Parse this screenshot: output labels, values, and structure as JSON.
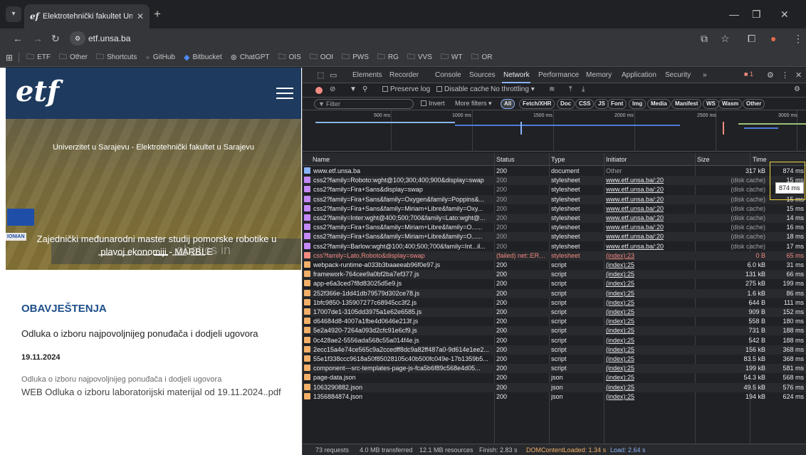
{
  "browser": {
    "tab_title": "Elektrotehnički fakultet Univerzi",
    "tab_favicon": "etf-logo",
    "url": "etf.unsa.ba",
    "bookmarks": [
      {
        "label": "ETF",
        "icon": "folder-icon"
      },
      {
        "label": "Other",
        "icon": "folder-icon"
      },
      {
        "label": "Shortcuts",
        "icon": "folder-icon"
      },
      {
        "label": "GitHub",
        "icon": "github-icon"
      },
      {
        "label": "Bitbucket",
        "icon": "bitbucket-icon"
      },
      {
        "label": "ChatGPT",
        "icon": "chatgpt-icon"
      },
      {
        "label": "OIS",
        "icon": "folder-icon"
      },
      {
        "label": "OOI",
        "icon": "folder-icon"
      },
      {
        "label": "PWS",
        "icon": "folder-icon"
      },
      {
        "label": "RG",
        "icon": "folder-icon"
      },
      {
        "label": "VVS",
        "icon": "folder-icon"
      },
      {
        "label": "WT",
        "icon": "folder-icon"
      },
      {
        "label": "OR",
        "icon": "folder-icon"
      }
    ]
  },
  "site": {
    "logo_text": "etf",
    "hero_university": "Univerzitet u Sarajevu - Elektrotehnički fakultet u Sarajevu",
    "hero_headline": "Zajednički međunarodni master studij pomorske robotike u plavoj ekonomiji - MARBLE",
    "hero_background_word": "obotics in",
    "hero_partner": "IONIAN",
    "news_section_title": "OBAVJEŠTENJA",
    "news_headline": "Odluka o izboru najpovoljnijeg ponuđača i dodjeli ugovora",
    "news_date": "19.11.2024",
    "news_excerpt": "Odluka o izboru najpovoljnijeg ponuđača i dodjeli ugovora",
    "news_file": "WEB Odluka o izboru laboratorijski materijal od 19.11.2024..pdf"
  },
  "devtools": {
    "tabs": [
      "Elements",
      "Recorder",
      "Console",
      "Sources",
      "Network",
      "Performance",
      "Memory",
      "Application",
      "Security"
    ],
    "active_tab": "Network",
    "error_badge": "1",
    "toolbar": {
      "preserve_log": "Preserve log",
      "disable_cache": "Disable cache",
      "throttling": "No throttling"
    },
    "filter": {
      "placeholder": "Filter",
      "invert": "Invert",
      "more_filters": "More filters",
      "chips": [
        "All",
        "Fetch/XHR",
        "Doc",
        "CSS",
        "JS",
        "Font",
        "Img",
        "Media",
        "Manifest",
        "WS",
        "Wasm",
        "Other"
      ]
    },
    "overview_ticks": [
      "500 ms",
      "1000 ms",
      "1500 ms",
      "2000 ms",
      "2500 ms",
      "3000 ms"
    ],
    "columns": {
      "name": "Name",
      "status": "Status",
      "type": "Type",
      "initiator": "Initiator",
      "size": "Size",
      "time": "Time"
    },
    "requests": [
      {
        "name": "www.etf.unsa.ba",
        "status": "200",
        "type": "document",
        "initiator": "Other",
        "size": "317 kB",
        "time": "874 ms",
        "kind": "doc"
      },
      {
        "name": "css2?family=Roboto:wght@100;300;400;900&display=swap",
        "status": "200",
        "type": "stylesheet",
        "initiator": "www.etf.unsa.ba/:20",
        "size": "(disk cache)",
        "time": "15 ms",
        "kind": "css"
      },
      {
        "name": "css2?family=Fira+Sans&display=swap",
        "status": "200",
        "type": "stylesheet",
        "initiator": "www.etf.unsa.ba/:20",
        "size": "(disk cache)",
        "time": "15 ms",
        "kind": "css"
      },
      {
        "name": "css2?family=Fira+Sans&family=Oxygen&family=Poppins&...",
        "status": "200",
        "type": "stylesheet",
        "initiator": "www.etf.unsa.ba/:20",
        "size": "(disk cache)",
        "time": "15 ms",
        "kind": "css"
      },
      {
        "name": "css2?family=Fira+Sans&family=Miriam+Libre&family=Oxy...",
        "status": "200",
        "type": "stylesheet",
        "initiator": "www.etf.unsa.ba/:20",
        "size": "(disk cache)",
        "time": "15 ms",
        "kind": "css"
      },
      {
        "name": "css2?family=Inter:wght@400;500;700&family=Lato:wght@...",
        "status": "200",
        "type": "stylesheet",
        "initiator": "www.etf.unsa.ba/:20",
        "size": "(disk cache)",
        "time": "14 ms",
        "kind": "css"
      },
      {
        "name": "css2?family=Fira+Sans&family=Miriam+Libre&family=O......",
        "status": "200",
        "type": "stylesheet",
        "initiator": "www.etf.unsa.ba/:20",
        "size": "(disk cache)",
        "time": "16 ms",
        "kind": "css"
      },
      {
        "name": "css2?family=Fira+Sans&family=Miriam+Libre&family=O......",
        "status": "200",
        "type": "stylesheet",
        "initiator": "www.etf.unsa.ba/:20",
        "size": "(disk cache)",
        "time": "18 ms",
        "kind": "css"
      },
      {
        "name": "css2?family=Barlow:wght@100;400;500;700&family=Int...il...",
        "status": "200",
        "type": "stylesheet",
        "initiator": "www.etf.unsa.ba/:20",
        "size": "(disk cache)",
        "time": "17 ms",
        "kind": "css"
      },
      {
        "name": "css?family=Lato,Roboto&display=swap",
        "status": "(failed) net::ERR...",
        "type": "stylesheet",
        "initiator": "(index):23",
        "size": "0 B",
        "time": "65 ms",
        "kind": "fail"
      },
      {
        "name": "webpack-runtime-a033b3baaeeab96f0e97.js",
        "status": "200",
        "type": "script",
        "initiator": "(index):25",
        "size": "6.0 kB",
        "time": "31 ms",
        "kind": "js"
      },
      {
        "name": "framework-764cee9a0bf2ba7ef377.js",
        "status": "200",
        "type": "script",
        "initiator": "(index):25",
        "size": "131 kB",
        "time": "66 ms",
        "kind": "js"
      },
      {
        "name": "app-e6a3ced7f8d83025d5e9.js",
        "status": "200",
        "type": "script",
        "initiator": "(index):25",
        "size": "275 kB",
        "time": "199 ms",
        "kind": "js"
      },
      {
        "name": "252f366e-1dd41db79579d302ce78.js",
        "status": "200",
        "type": "script",
        "initiator": "(index):25",
        "size": "1.6 kB",
        "time": "86 ms",
        "kind": "js"
      },
      {
        "name": "1bfc9850-135907277c68945cc3f2.js",
        "status": "200",
        "type": "script",
        "initiator": "(index):25",
        "size": "644 B",
        "time": "111 ms",
        "kind": "js"
      },
      {
        "name": "17007de1-3105dd3975a1e62e6585.js",
        "status": "200",
        "type": "script",
        "initiator": "(index):25",
        "size": "909 B",
        "time": "152 ms",
        "kind": "js"
      },
      {
        "name": "d64684d8-4007a1fbe4d0646e213f.js",
        "status": "200",
        "type": "script",
        "initiator": "(index):25",
        "size": "558 B",
        "time": "180 ms",
        "kind": "js"
      },
      {
        "name": "5e2a4920-7264a093d2cfc91e6cf9.js",
        "status": "200",
        "type": "script",
        "initiator": "(index):25",
        "size": "731 B",
        "time": "188 ms",
        "kind": "js"
      },
      {
        "name": "0c428ae2-5556ada568c55a014f4e.js",
        "status": "200",
        "type": "script",
        "initiator": "(index):25",
        "size": "542 B",
        "time": "188 ms",
        "kind": "js"
      },
      {
        "name": "2ecc15a4e74ce565c9a2ccedff8dc9a82ff487a0-9d614e1ee2...",
        "status": "200",
        "type": "script",
        "initiator": "(index):25",
        "size": "156 kB",
        "time": "368 ms",
        "kind": "js"
      },
      {
        "name": "55e1f338ccc9618a50f85028105c40b500fc049e-17b1359b5...",
        "status": "200",
        "type": "script",
        "initiator": "(index):25",
        "size": "83.5 kB",
        "time": "368 ms",
        "kind": "js"
      },
      {
        "name": "component---src-templates-page-js-fca5b6f89c568e4d05...",
        "status": "200",
        "type": "script",
        "initiator": "(index):25",
        "size": "199 kB",
        "time": "581 ms",
        "kind": "js"
      },
      {
        "name": "page-data.json",
        "status": "200",
        "type": "json",
        "initiator": "(index):25",
        "size": "54.3 kB",
        "time": "568 ms",
        "kind": "json"
      },
      {
        "name": "1063290882.json",
        "status": "200",
        "type": "json",
        "initiator": "(index):25",
        "size": "49.5 kB",
        "time": "576 ms",
        "kind": "json"
      },
      {
        "name": "1356884874.json",
        "status": "200",
        "type": "json",
        "initiator": "(index):25",
        "size": "194 kB",
        "time": "624 ms",
        "kind": "json"
      }
    ],
    "tooltip": "874 ms",
    "status": {
      "requests": "73 requests",
      "transferred": "4.0 MB transferred",
      "resources": "12.1 MB resources",
      "finish": "Finish: 2.83 s",
      "dcl": "DOMContentLoaded: 1.34 s",
      "load": "Load: 2.64 s"
    },
    "colors": {
      "dcl": "#8ab4f8",
      "load": "#f28b82",
      "error": "#f28b82",
      "highlight": "#f0d53b"
    }
  }
}
